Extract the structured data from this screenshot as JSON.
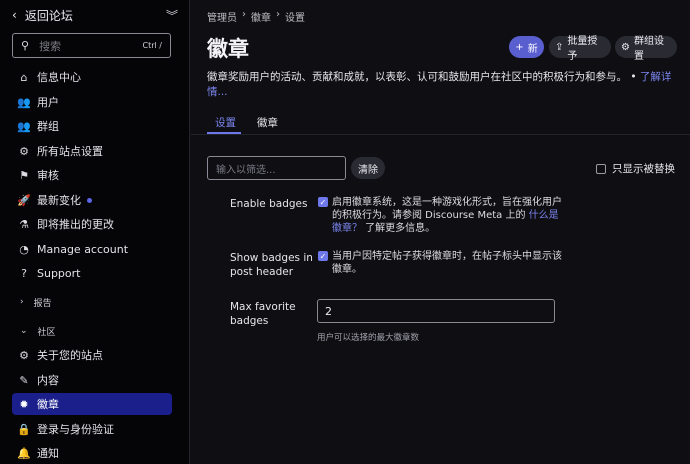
{
  "sidebar": {
    "back_label": "返回论坛",
    "back_icon": "chevron-left-icon",
    "collapse_icon": "double-chevron-down-icon",
    "filter": {
      "placeholder": "搜索",
      "shortcut": "Ctrl /"
    },
    "items": [
      {
        "label": "信息中心",
        "icon": "home-icon"
      },
      {
        "label": "用户",
        "icon": "users-icon"
      },
      {
        "label": "群组",
        "icon": "groups-icon"
      },
      {
        "label": "所有站点设置",
        "icon": "gear-icon"
      },
      {
        "label": "审核",
        "icon": "flag-icon"
      },
      {
        "label": "最新变化",
        "icon": "rocket-icon"
      },
      {
        "label": "即将推出的更改",
        "icon": "flask-icon"
      },
      {
        "label": "Manage account",
        "icon": "gauge-icon"
      },
      {
        "label": "Support",
        "icon": "question-icon"
      }
    ],
    "section_reports": "报告",
    "section_community": "社区",
    "community_items": [
      {
        "label": "关于您的站点",
        "icon": "gear-icon"
      },
      {
        "label": "内容",
        "icon": "pencil-icon"
      },
      {
        "label": "徽章",
        "icon": "badge-icon",
        "active": true
      },
      {
        "label": "登录与身份验证",
        "icon": "lock-icon"
      },
      {
        "label": "通知",
        "icon": "bell-icon"
      }
    ]
  },
  "main": {
    "breadcrumb": [
      "管理员",
      "徽章",
      "设置"
    ],
    "title": "徽章",
    "new_button": "新",
    "bulk_button": "批量授予",
    "group_settings_button": "群组设置",
    "description": "徽章奖励用户的活动、贡献和成就，以表彰、认可和鼓励用户在社区中的积极行为和参与。",
    "learn_more": "了解详情...",
    "tabs": [
      "设置",
      "徽章"
    ],
    "filter_placeholder": "输入以筛选...",
    "clear_button": "清除",
    "only_overridden": "只显示被替换",
    "settings": [
      {
        "label": "Enable badges",
        "checked": true,
        "desc_pre": "启用徽章系统，这是一种游戏化形式，旨在强化用户的积极行为。请参阅 Discourse Meta 上的 ",
        "desc_link": "什么是徽章？",
        "desc_post": " 了解更多信息。"
      },
      {
        "label": "Show badges in post header",
        "checked": true,
        "desc": "当用户因特定帖子获得徽章时，在帖子标头中显示该徽章。"
      },
      {
        "label": "Max favorite badges",
        "value": "2",
        "hint": "用户可以选择的最大徽章数"
      }
    ]
  },
  "colors": {
    "accent": "#5a5fd0",
    "active_nav": "#1b1f8c",
    "link": "#7c86ef"
  }
}
